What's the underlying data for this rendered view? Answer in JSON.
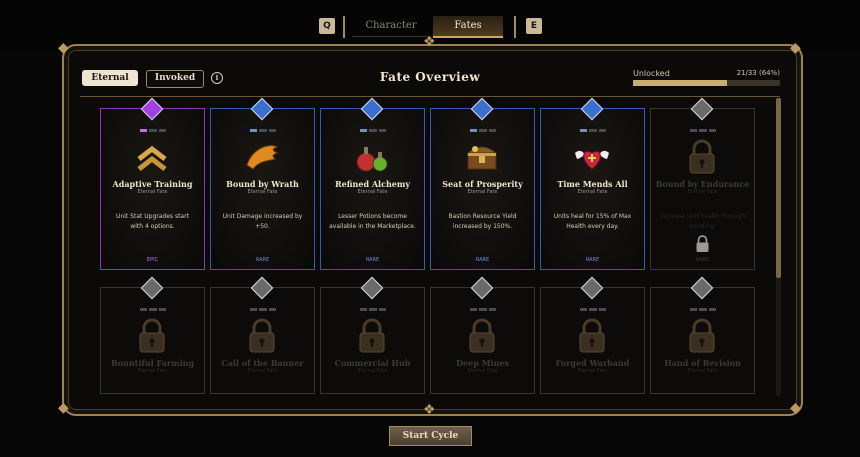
{
  "top_nav": {
    "prev_key": "Q",
    "next_key": "E",
    "tabs": [
      {
        "label": "Character",
        "active": false
      },
      {
        "label": "Fates",
        "active": true
      }
    ]
  },
  "header": {
    "toggle_eternal": "Eternal",
    "toggle_invoked": "Invoked",
    "info_icon": "i",
    "title": "Fate Overview",
    "unlocked_label": "Unlocked",
    "unlocked_value": "21/33 (64%)",
    "unlocked_fraction": 0.64
  },
  "cards_row1": [
    {
      "name": "Adaptive Training",
      "sub": "Eternal Fate",
      "desc": "Unit Stat Upgrades start with 4 options.",
      "rarity": "EPIC",
      "gem_color": "#a040e0",
      "dot_color": "#c070f0",
      "icon": "chevron-stack-icon",
      "accent": "#8a3ab8"
    },
    {
      "name": "Bound by Wrath",
      "sub": "Eternal Fate",
      "desc": "Unit Damage increased by +50.",
      "rarity": "RARE",
      "gem_color": "#3a6fd0",
      "dot_color": "#6a8fe0",
      "icon": "wing-icon",
      "accent": "#3a5ab0"
    },
    {
      "name": "Refined Alchemy",
      "sub": "Eternal Fate",
      "desc": "Lesser Potions become available in the Marketplace.",
      "rarity": "RARE",
      "gem_color": "#3a6fd0",
      "dot_color": "#6a8fe0",
      "icon": "potion-icon",
      "accent": "#3a5ab0"
    },
    {
      "name": "Seat of Prosperity",
      "sub": "Eternal Fate",
      "desc": "Bastion Resource Yield increased by 150%.",
      "rarity": "RARE",
      "gem_color": "#3a6fd0",
      "dot_color": "#6a8fe0",
      "icon": "chest-icon",
      "accent": "#3a5ab0"
    },
    {
      "name": "Time Mends All",
      "sub": "Eternal Fate",
      "desc": "Units heal for 15% of Max Health every day.",
      "rarity": "RARE",
      "gem_color": "#3a6fd0",
      "dot_color": "#6a8fe0",
      "icon": "winged-heart-icon",
      "accent": "#3a5ab0"
    },
    {
      "name": "Bound by Endurance",
      "sub": "Eternal Fate",
      "desc": "Increase unit health through bonding.",
      "rarity": "RARE",
      "gem_color": "#888888",
      "dot_color": "#444444",
      "icon": "lock-icon",
      "accent": "#2a2620",
      "locked": true
    }
  ],
  "cards_row2": [
    {
      "name": "Bountiful Farming",
      "sub": "Eternal Fate"
    },
    {
      "name": "Call of the Banner",
      "sub": "Eternal Fate"
    },
    {
      "name": "Commercial Hub",
      "sub": "Eternal Fate"
    },
    {
      "name": "Deep Mines",
      "sub": "Eternal Fate"
    },
    {
      "name": "Forged Warband",
      "sub": "Eternal Fate"
    },
    {
      "name": "Hand of Revision",
      "sub": "Eternal Fate"
    }
  ],
  "footer": {
    "start_button": "Start Cycle"
  }
}
